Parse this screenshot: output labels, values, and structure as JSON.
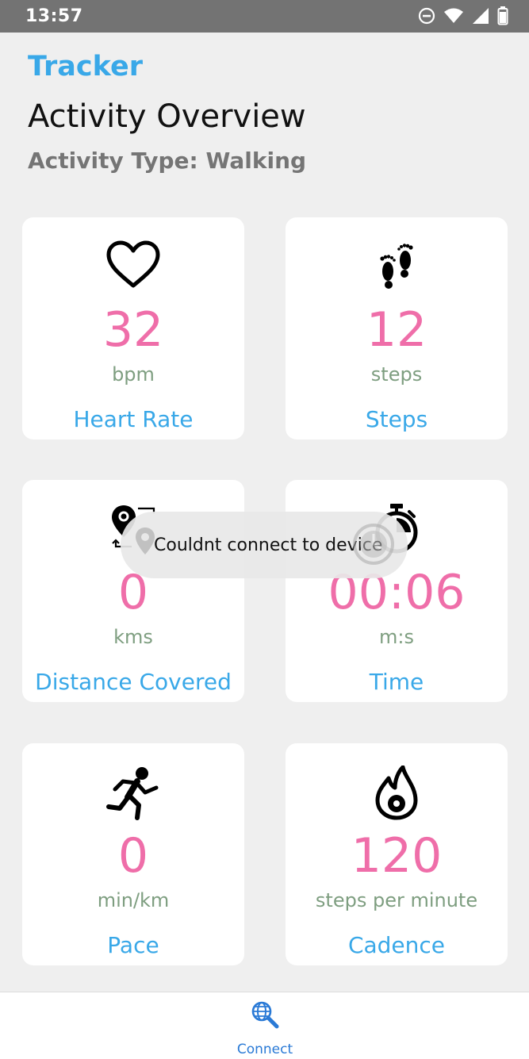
{
  "status_bar": {
    "time": "13:57",
    "icons": [
      "dnd-icon",
      "wifi-icon",
      "signal-icon",
      "battery-icon"
    ]
  },
  "header": {
    "app_name": "Tracker",
    "title": "Activity Overview",
    "activity_type": "Activity Type: Walking"
  },
  "cards": [
    {
      "icon": "heart-icon",
      "value": "32",
      "unit": "bpm",
      "label": "Heart Rate"
    },
    {
      "icon": "footprints-icon",
      "value": "12",
      "unit": "steps",
      "label": "Steps"
    },
    {
      "icon": "route-pin-icon",
      "value": "0",
      "unit": "kms",
      "label": "Distance Covered"
    },
    {
      "icon": "stopwatch-icon",
      "value": "00:06",
      "unit": "m:s",
      "label": "Time"
    },
    {
      "icon": "running-icon",
      "value": "0",
      "unit": "min/km",
      "label": "Pace"
    },
    {
      "icon": "fire-icon",
      "value": "120",
      "unit": "steps per minute",
      "label": "Cadence"
    }
  ],
  "toast": {
    "message": "Couldnt connect to device"
  },
  "bottom_nav": {
    "items": [
      {
        "icon": "globe-search-icon",
        "label": "Connect"
      }
    ]
  },
  "colors": {
    "accent": "#39a8e8",
    "value": "#ef6ea9",
    "unit": "#7e9e80",
    "background": "#efefef",
    "nav_label": "#2a7ad6"
  }
}
